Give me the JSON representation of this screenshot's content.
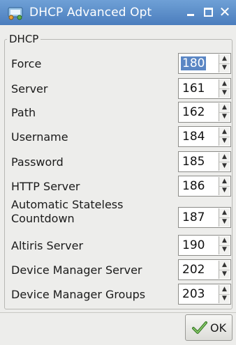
{
  "window": {
    "title": "DHCP Advanced Opt"
  },
  "group": {
    "title": "DHCP"
  },
  "options": [
    {
      "label": "Force",
      "value": "180",
      "selected": true
    },
    {
      "label": "Server",
      "value": "161"
    },
    {
      "label": "Path",
      "value": "162"
    },
    {
      "label": "Username",
      "value": "184"
    },
    {
      "label": "Password",
      "value": "185"
    },
    {
      "label": "HTTP Server",
      "value": "186"
    },
    {
      "label": "Automatic Stateless Countdown",
      "label_lines": [
        "Automatic Stateless",
        "Countdown"
      ],
      "value": "187"
    },
    {
      "label": "Altiris Server",
      "value": "190"
    },
    {
      "label": "Device Manager Server",
      "value": "202"
    },
    {
      "label": "Device Manager Groups",
      "value": "203"
    }
  ],
  "footer": {
    "ok_label": "OK"
  },
  "icons": {
    "window": "network-settings-icon",
    "minimize": "minimize-icon",
    "maximize": "maximize-icon",
    "close": "close-icon",
    "ok": "check-arrow-icon",
    "spin_up": "triangle-up-icon",
    "spin_down": "triangle-down-icon"
  },
  "colors": {
    "titlebar": "#4a7dbd",
    "selection": "#5a86c4",
    "window_bg": "#ededeb"
  }
}
